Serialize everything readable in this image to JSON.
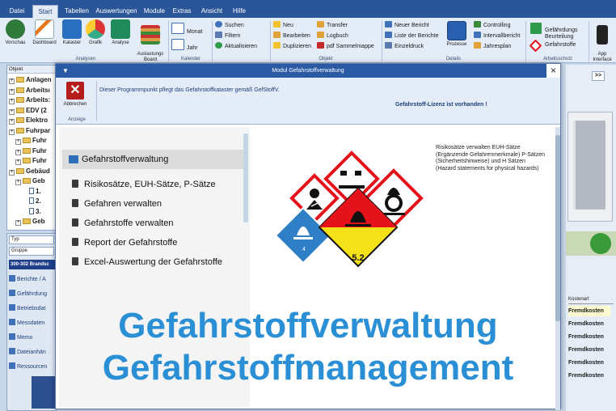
{
  "menu": {
    "tabs": [
      "Datei",
      "Start",
      "Tabellen",
      "Auswertungen",
      "Module",
      "Extras",
      "Ansicht",
      "Hilfe"
    ],
    "active": "Start"
  },
  "ribbon": {
    "analysen": {
      "label": "Analysen",
      "buttons": [
        "Vorschau",
        "Dashboard",
        "Kataster",
        "Grafik",
        "Analyse",
        "Auslastungs\nBoard"
      ]
    },
    "kalender": {
      "label": "Kalender",
      "buttons": [
        "Monat",
        "Jahr"
      ]
    },
    "search": {
      "items": [
        "Suchen",
        "Filtern",
        "Aktualisieren"
      ]
    },
    "objekt": {
      "label": "Objekt",
      "items": [
        "Neu",
        "Bearbeiten",
        "Duplizieren",
        "Transfer",
        "Logbuch",
        "pdf Sammelmappe"
      ]
    },
    "details": {
      "label": "Details",
      "items": [
        "Neuer Bericht",
        "Liste der Berichte",
        "Einzeldruck"
      ],
      "prozesse": "Prozesse",
      "right_items": [
        "Controlling",
        "Intervallbericht",
        "Jahresplan"
      ]
    },
    "arbeitsschutz": {
      "label": "Arbeitsschutz",
      "items": [
        "Gefährdungs\nBeurteilung",
        "Gefahrstoffe"
      ]
    },
    "app": {
      "label": "App\nInterface"
    }
  },
  "tree": {
    "header": "Objekt",
    "items": [
      {
        "label": "Anlagen",
        "type": "folder",
        "level": 0
      },
      {
        "label": "Arbeitsı",
        "type": "folder",
        "level": 0
      },
      {
        "label": "Arbeits:",
        "type": "folder",
        "level": 0
      },
      {
        "label": "EDV (2",
        "type": "folder",
        "level": 0
      },
      {
        "label": "Elektro",
        "type": "folder",
        "level": 0
      },
      {
        "label": "Fuhrpar",
        "type": "folder",
        "level": 0
      },
      {
        "label": "Fuhr",
        "type": "folder",
        "level": 1
      },
      {
        "label": "Fuhr",
        "type": "folder",
        "level": 1
      },
      {
        "label": "Fuhr",
        "type": "folder",
        "level": 1
      },
      {
        "label": "Gebäud",
        "type": "folder",
        "level": 0
      },
      {
        "label": "Geb",
        "type": "folder",
        "level": 1
      },
      {
        "label": "1.",
        "type": "doc",
        "level": 2
      },
      {
        "label": "2.",
        "type": "doc",
        "level": 2
      },
      {
        "label": "3.",
        "type": "doc",
        "level": 2
      },
      {
        "label": "Geb",
        "type": "folder",
        "level": 1
      }
    ]
  },
  "lower_left": {
    "fields": [
      "Typ",
      "Gruppe"
    ],
    "selected": "300-302 Brandsc",
    "items": [
      "Berichte / A",
      "Gefährdung",
      "Betriebsdat",
      "Messdaten",
      "Memo",
      "Dateianhän",
      "Ressourcen"
    ]
  },
  "right": {
    "expand_button": ">>",
    "column_header": "Kostenart",
    "rows": [
      "Fremdkosten",
      "Fremdkosten",
      "Fremdkosten",
      "Fremdkosten",
      "Fremdkosten",
      "Fremdkosten"
    ]
  },
  "modal": {
    "title": "Modul Gefahrstoffverwaltung",
    "close": "×",
    "ribbon": {
      "button": "Abbrechen",
      "group": "Anzeige"
    },
    "info_text": "Dieser Programmpunkt pflegt das Gefahrstoffkataster gemäß GefStoffV.",
    "license_text": "Gefahrstoff-Lizenz ist vorhanden !",
    "nav": {
      "header": "Gefahrstoffverwaltung",
      "items": [
        "Risikosätze, EUH-Sätze, P-Sätze",
        "Gefahren verwalten",
        "Gefahrstoffe verwalten",
        "Report der Gefahrstoffe",
        "Excel-Auswertung der Gefahrstoffe"
      ]
    },
    "hazard_info": [
      "Risikosätze verwalten  EUH-Sätze",
      "(Ergänzende Gefahrenmerkmale) P-Sätzen",
      "(Sicherheitshinweise) und H Sätzen",
      "(Hazard statements for physical hazards)"
    ],
    "diamond_labels": {
      "flammable_solid": "4",
      "organic_peroxide": "5.2"
    }
  },
  "overlay": {
    "line1": "Gefahrstoffverwaltung",
    "line2": "Gefahrstoffmanagement"
  },
  "colors": {
    "menu_bar": "#2a5699",
    "modal_title": "#2b5aa5",
    "overlay_text": "#2b8fd6",
    "ghs_red": "#e3121b",
    "diamond_blue": "#2f7fc6",
    "diamond_yellow": "#f4e11a"
  }
}
